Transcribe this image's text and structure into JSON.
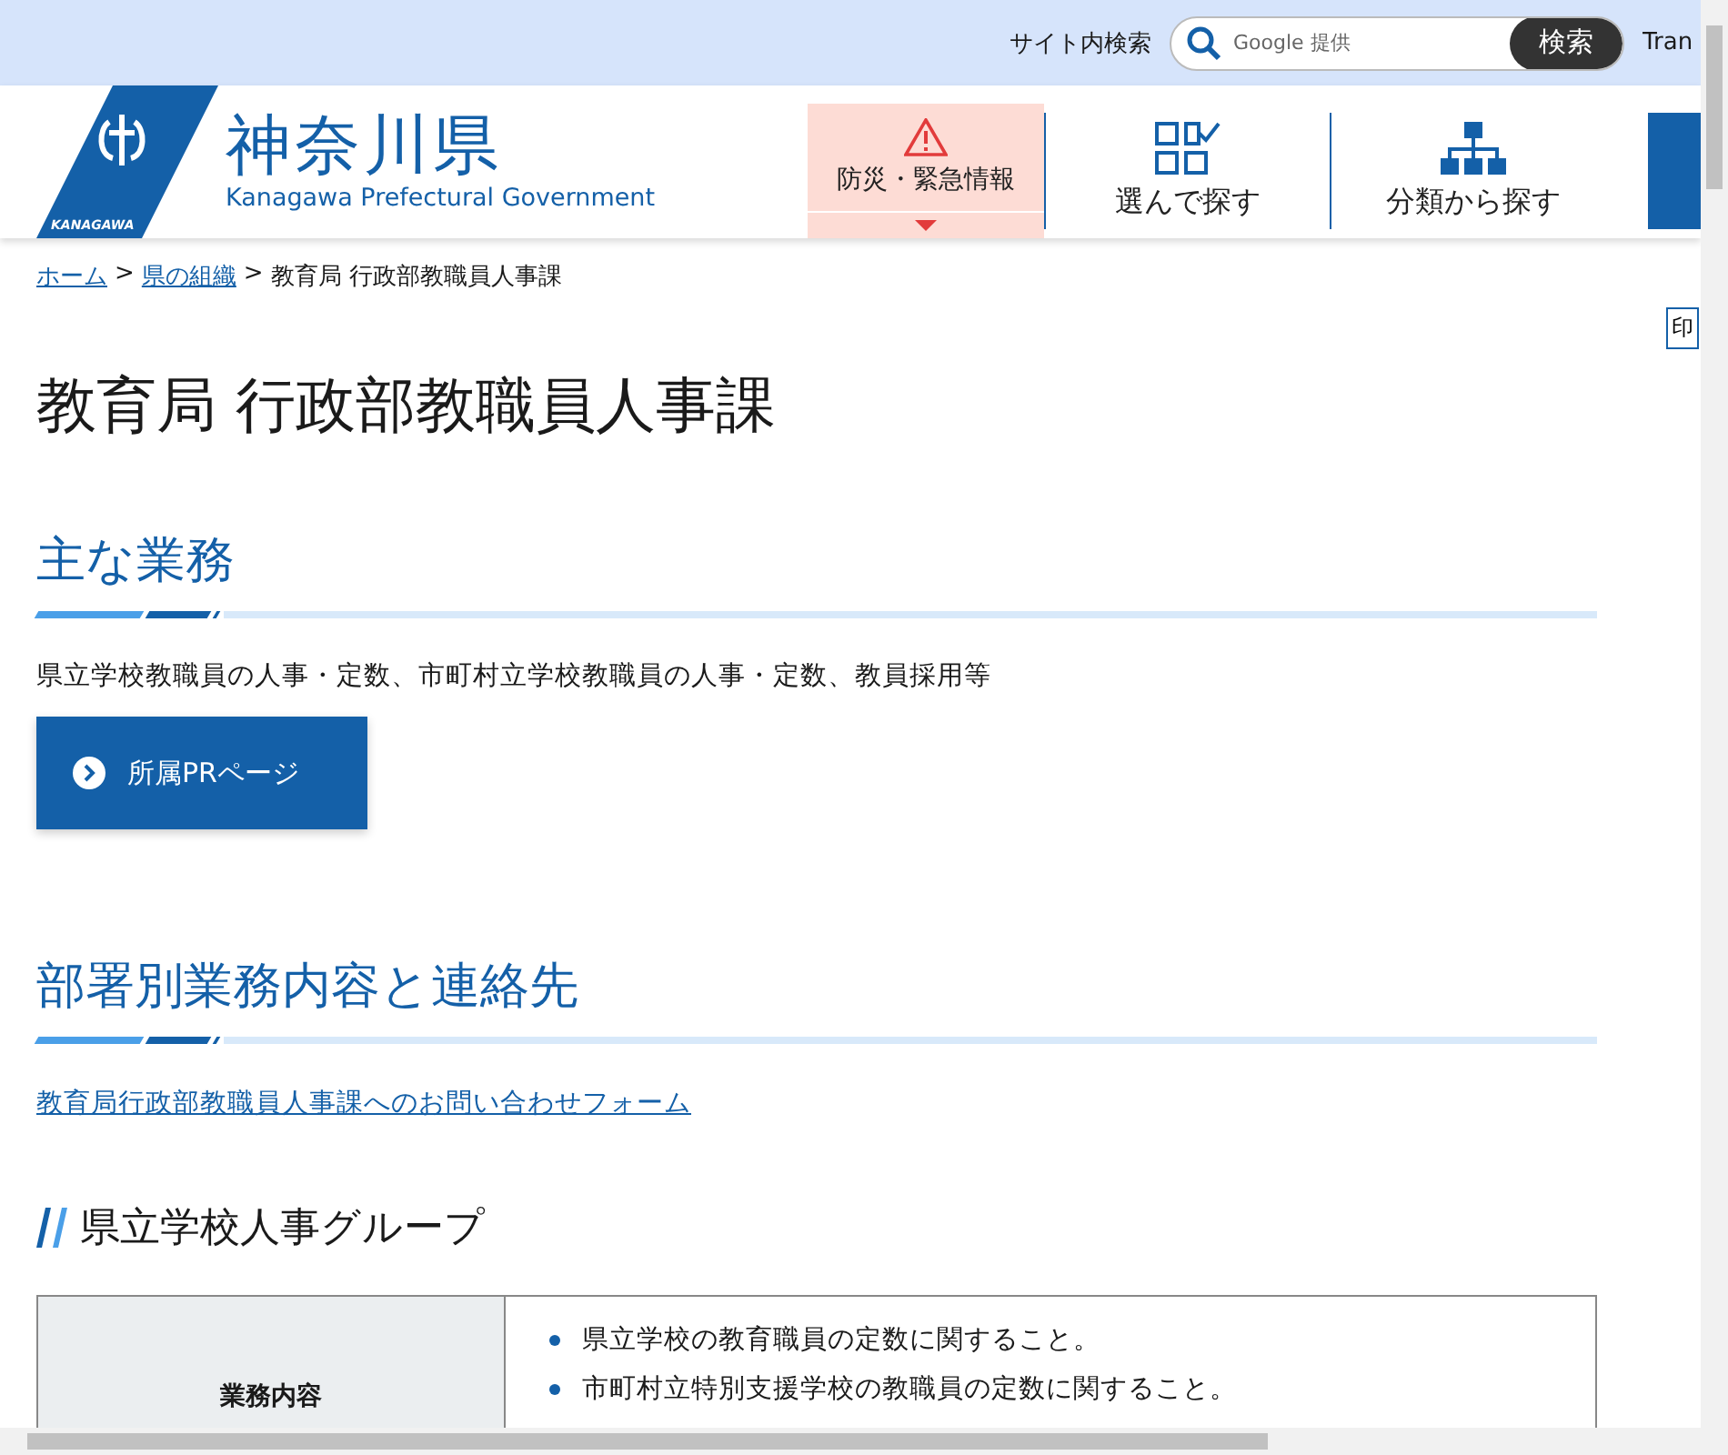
{
  "top_bar": {
    "search_label": "サイト内検索",
    "search": {
      "placeholder": "Google 提供"
    },
    "search_button": "検索",
    "translate": "Tran"
  },
  "logo": {
    "badge": "KANAGAWA",
    "title": "神奈川県",
    "subtitle": "Kanagawa Prefectural Government"
  },
  "nav": [
    {
      "kind": "alert",
      "label": "防災・緊急情報"
    },
    {
      "kind": "choose",
      "label": "選んで探す"
    },
    {
      "kind": "category",
      "label": "分類から探す"
    }
  ],
  "breadcrumb": [
    {
      "label": "ホーム",
      "link": true
    },
    {
      "separator": ">",
      "label": "県の組織",
      "link": true
    },
    {
      "separator": ">",
      "label": "教育局 行政部教職員人事課",
      "link": false
    }
  ],
  "print_button": "印",
  "page_title": "教育局 行政部教職員人事課",
  "sections": [
    {
      "heading": "主な業務",
      "body": "県立学校教職員の人事・定数、市町村立学校教職員の人事・定数、教員採用等",
      "button": "所属PRページ"
    },
    {
      "heading": "部署別業務内容と連絡先",
      "link": "教育局行政部教職員人事課へのお問い合わせフォーム"
    }
  ],
  "group": {
    "heading": "県立学校人事グループ",
    "table": {
      "header": "業務内容",
      "items": [
        "県立学校の教育職員の定数に関すること。",
        "市町村立特別支援学校の教職員の定数に関すること。"
      ]
    }
  }
}
